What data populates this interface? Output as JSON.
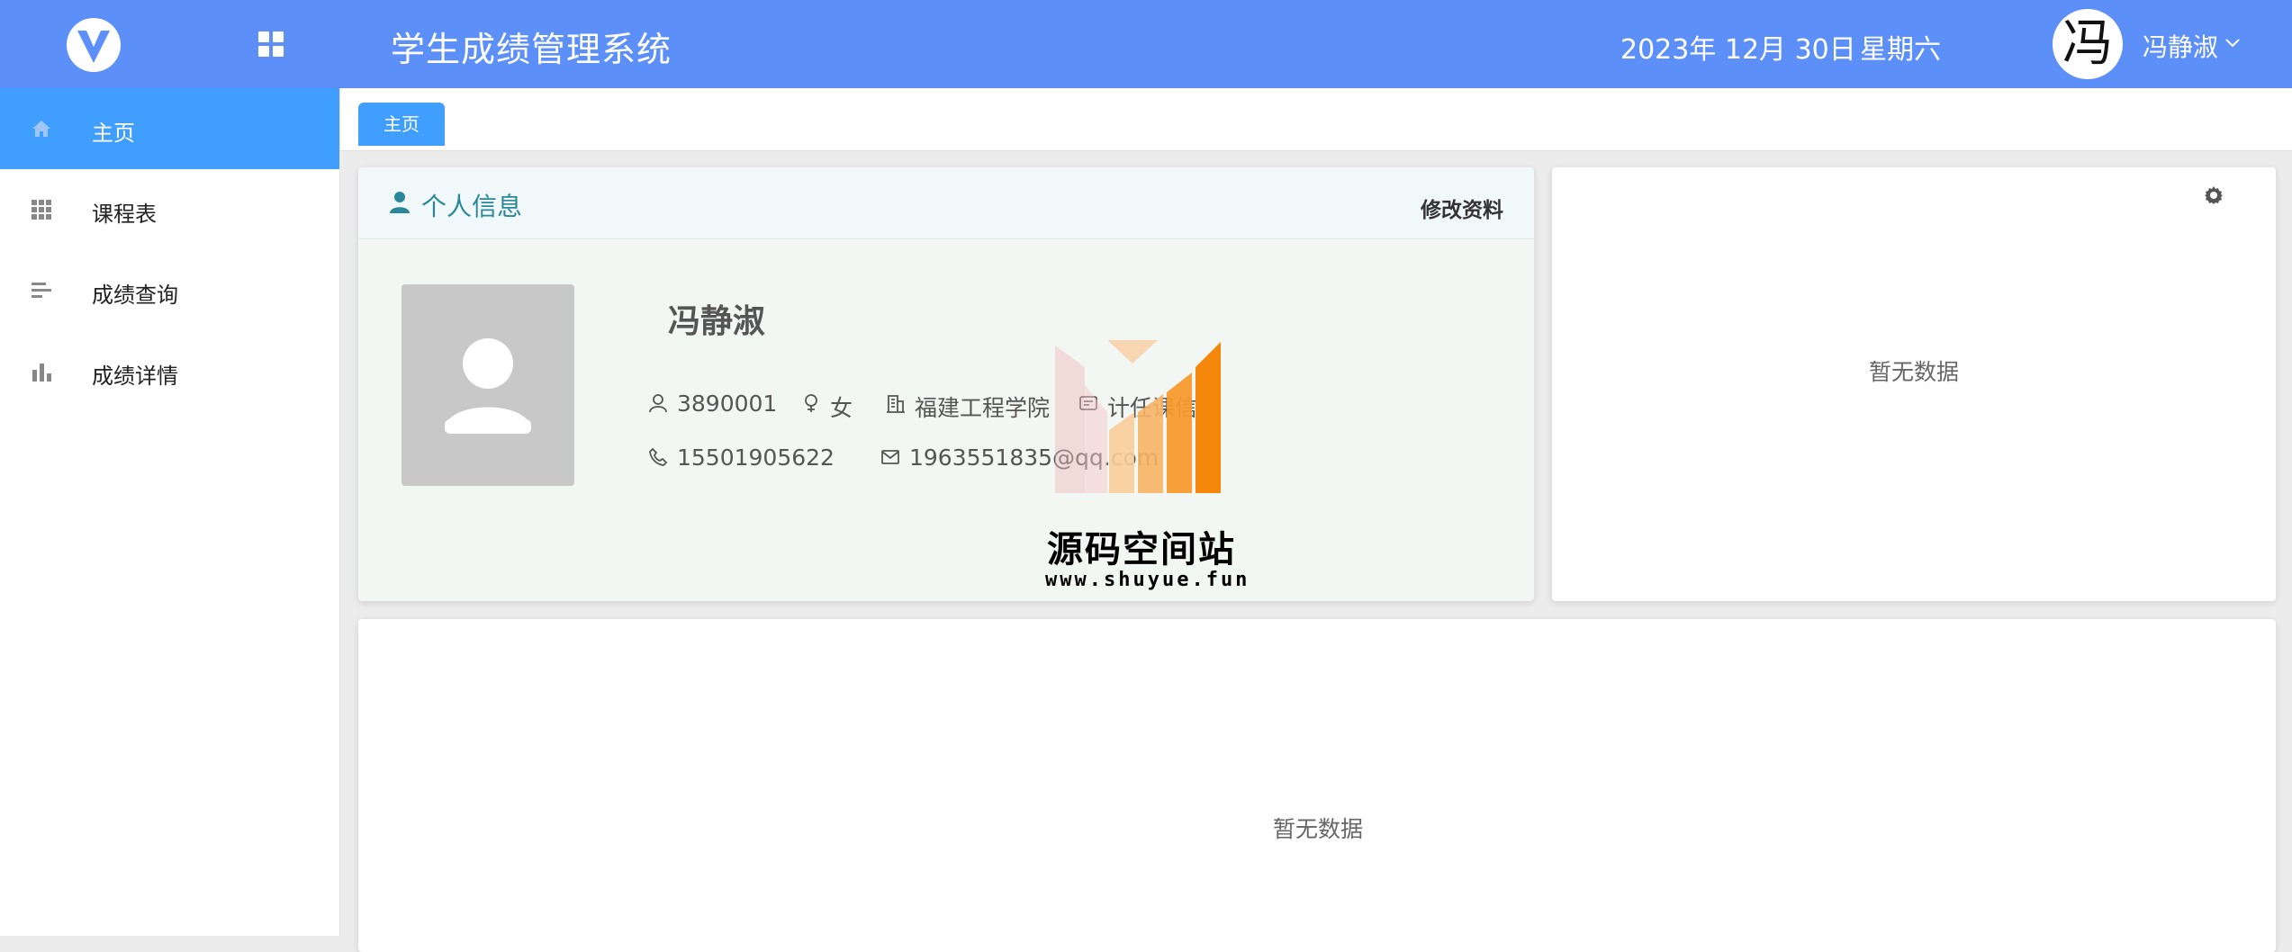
{
  "header": {
    "app_title": "学生成绩管理系统",
    "date": "2023年 12月 30日",
    "weekday": "星期六",
    "avatar_char": "冯",
    "username": "冯静淑"
  },
  "colors": {
    "header_bg": "#5d8ff9",
    "active": "#409eff",
    "title_accent": "#2a8799"
  },
  "sidebar": {
    "items": [
      {
        "label": "主页",
        "icon": "home-icon",
        "active": true
      },
      {
        "label": "课程表",
        "icon": "grid-icon",
        "active": false
      },
      {
        "label": "成绩查询",
        "icon": "list-icon",
        "active": false
      },
      {
        "label": "成绩详情",
        "icon": "bar-chart-icon",
        "active": false
      }
    ]
  },
  "tabs": [
    {
      "label": "主页",
      "active": true
    }
  ],
  "profile": {
    "section_title": "个人信息",
    "edit_label": "修改资料",
    "name": "冯静淑",
    "student_id": "3890001",
    "gender": "女",
    "school": "福建工程学院",
    "major": "计任课信息",
    "phone": "15501905622",
    "email": "1963551835@qq.com"
  },
  "side_panel": {
    "empty_text": "暂无数据"
  },
  "bottom_panel": {
    "empty_text": "暂无数据"
  },
  "watermark": {
    "title": "源码空间站",
    "url": "www.shuyue.fun"
  }
}
